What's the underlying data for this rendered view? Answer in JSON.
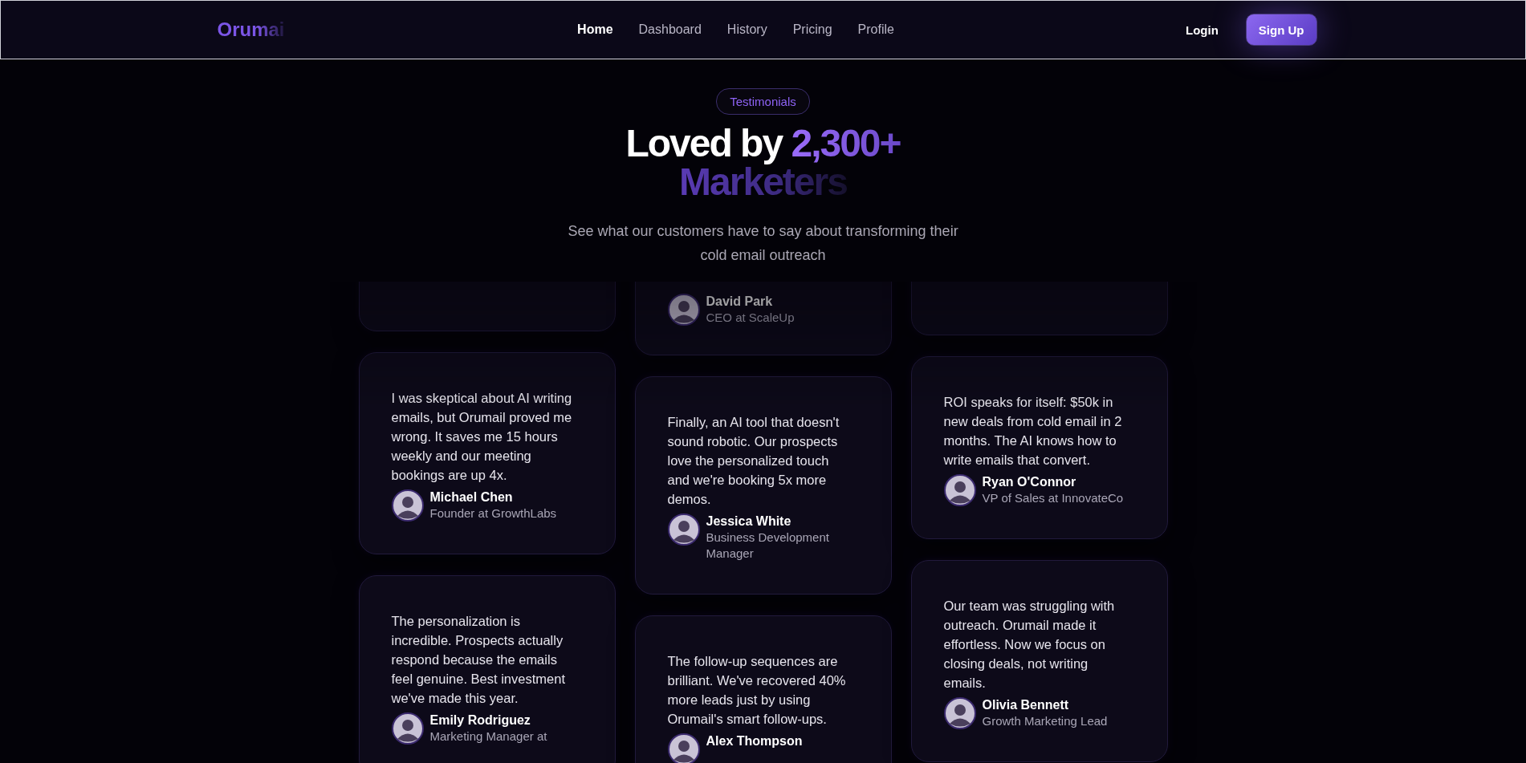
{
  "nav": {
    "logo": "Orumai",
    "links": [
      {
        "label": "Home",
        "selected": true
      },
      {
        "label": "Dashboard",
        "selected": false
      },
      {
        "label": "History",
        "selected": false
      },
      {
        "label": "Pricing",
        "selected": false
      },
      {
        "label": "Profile",
        "selected": false
      }
    ],
    "login": "Login",
    "signup": "Sign Up"
  },
  "header": {
    "badge": "Testimonials",
    "title_lead": "Loved by",
    "title_number": "2,300+",
    "title_word": "Marketers",
    "subtitle": "See what our customers have to say about transforming their cold email outreach"
  },
  "columns": [
    {
      "cards": [
        {
          "kind": "cut"
        },
        {
          "kind": "full",
          "quote": "I was skeptical about AI writing emails, but Orumail proved me wrong. It saves me 15 hours weekly and our meeting bookings are up 4x.",
          "name": "Michael Chen",
          "role": "Founder at GrowthLabs"
        },
        {
          "kind": "full",
          "quote": "The personalization is incredible. Prospects actually respond because the emails feel genuine. Best investment we've made this year.",
          "name": "Emily Rodriguez",
          "role": "Marketing Manager at"
        }
      ]
    },
    {
      "cards": [
        {
          "kind": "cut",
          "name": "David Park",
          "role": "CEO at ScaleUp"
        },
        {
          "kind": "full",
          "quote": "Finally, an AI tool that doesn't sound robotic. Our prospects love the personalized touch and we're booking 5x more demos.",
          "name": "Jessica White",
          "role": "Business Development Manager"
        },
        {
          "kind": "full",
          "quote": "The follow-up sequences are brilliant. We've recovered 40% more leads just by using Orumail's smart follow-ups.",
          "name": "Alex Thompson"
        }
      ]
    },
    {
      "cards": [
        {
          "kind": "cut"
        },
        {
          "kind": "full",
          "quote": "ROI speaks for itself: $50k in new deals from cold email in 2 months. The AI knows how to write emails that convert.",
          "name": "Ryan O'Connor",
          "role": "VP of Sales at InnovateCo"
        },
        {
          "kind": "full",
          "quote": "Our team was struggling with outreach. Orumail made it effortless. Now we focus on closing deals, not writing emails.",
          "name": "Olivia Bennett",
          "role": "Growth Marketing Lead"
        }
      ]
    }
  ]
}
